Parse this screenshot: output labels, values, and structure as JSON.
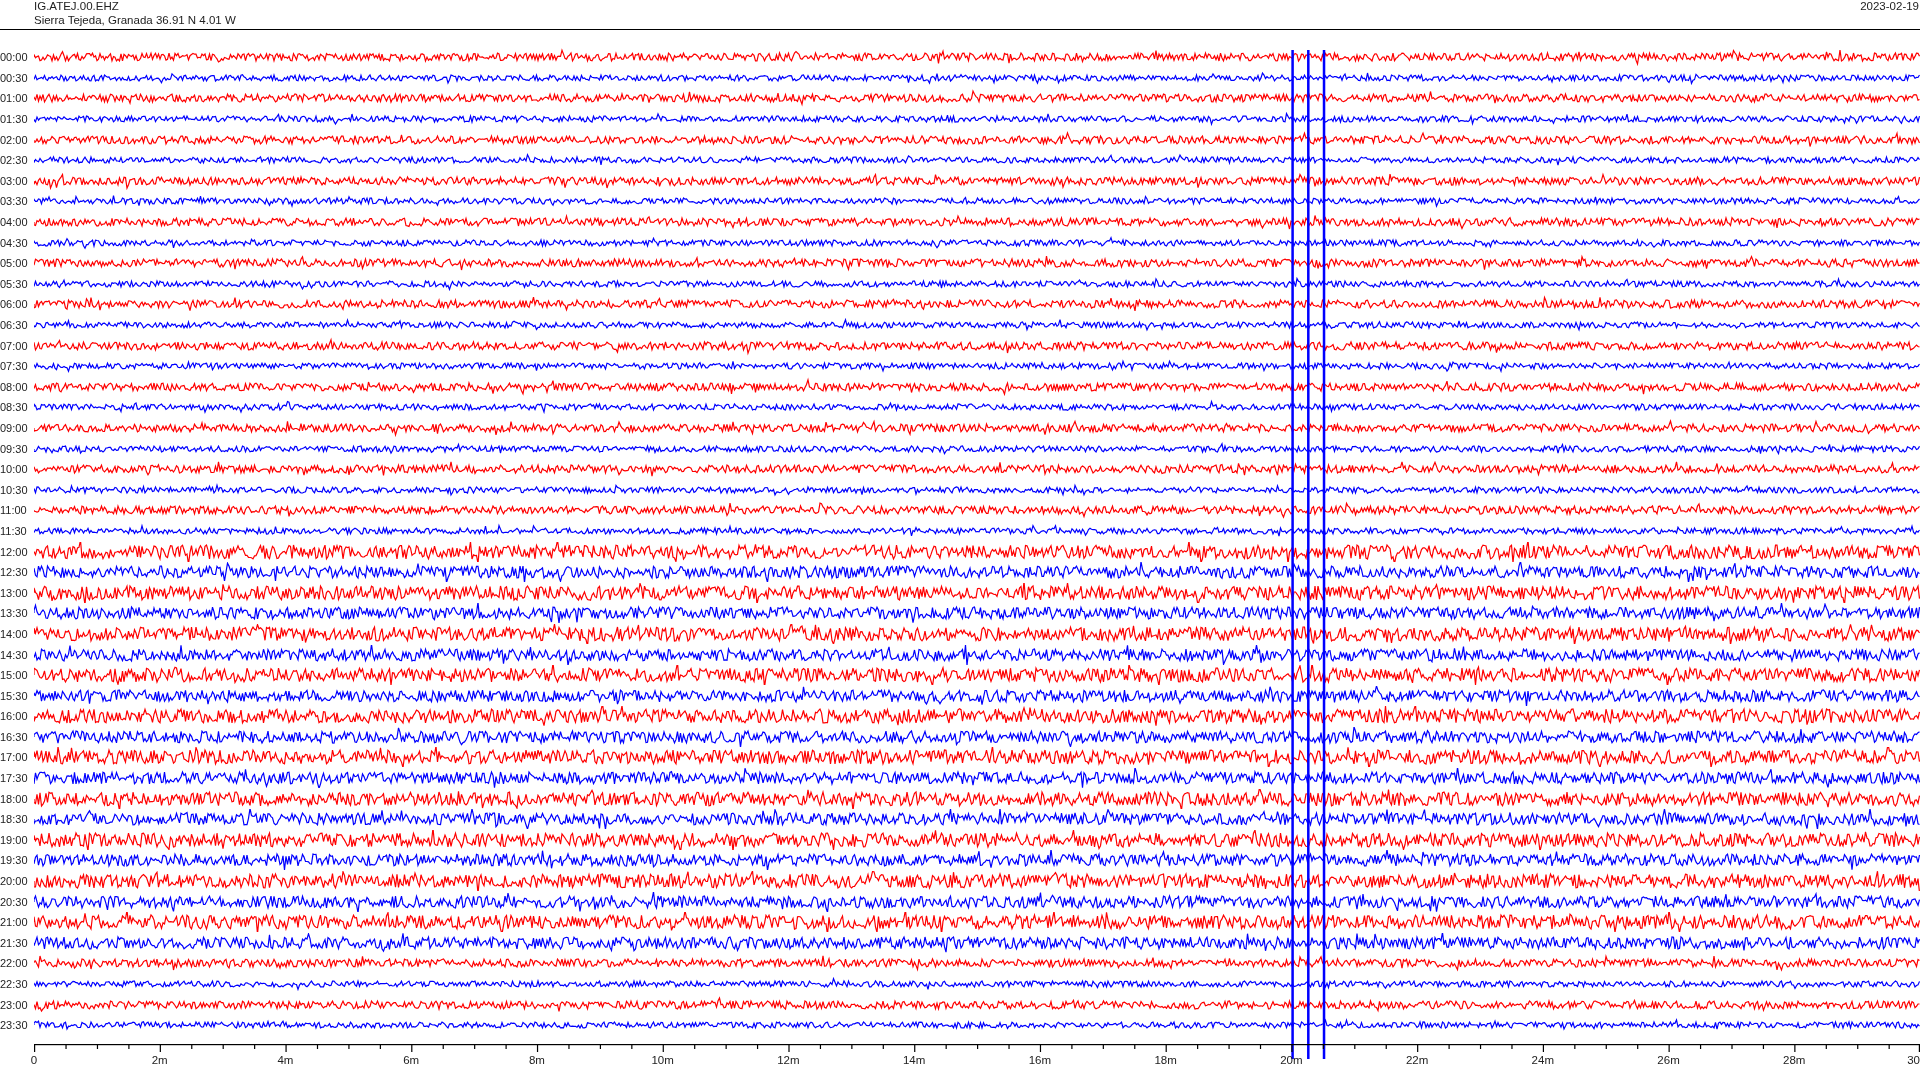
{
  "header": {
    "station": "IG.ATEJ.00.EHZ",
    "location": "Sierra Tejeda, Granada  36.91 N 4.01 W",
    "date": "2023-02-19"
  },
  "traces": [
    {
      "time": "00:00",
      "color": "#ff0000"
    },
    {
      "time": "00:30",
      "color": "#0000ff"
    },
    {
      "time": "01:00",
      "color": "#ff0000"
    },
    {
      "time": "01:30",
      "color": "#0000ff"
    },
    {
      "time": "02:00",
      "color": "#ff0000"
    },
    {
      "time": "02:30",
      "color": "#0000ff"
    },
    {
      "time": "03:00",
      "color": "#ff0000"
    },
    {
      "time": "03:30",
      "color": "#0000ff"
    },
    {
      "time": "04:00",
      "color": "#ff0000"
    },
    {
      "time": "04:30",
      "color": "#0000ff"
    },
    {
      "time": "05:00",
      "color": "#ff0000"
    },
    {
      "time": "05:30",
      "color": "#0000ff"
    },
    {
      "time": "06:00",
      "color": "#ff0000"
    },
    {
      "time": "06:30",
      "color": "#0000ff"
    },
    {
      "time": "07:00",
      "color": "#ff0000"
    },
    {
      "time": "07:30",
      "color": "#0000ff"
    },
    {
      "time": "08:00",
      "color": "#ff0000"
    },
    {
      "time": "08:30",
      "color": "#0000ff"
    },
    {
      "time": "09:00",
      "color": "#ff0000"
    },
    {
      "time": "09:30",
      "color": "#0000ff"
    },
    {
      "time": "10:00",
      "color": "#ff0000"
    },
    {
      "time": "10:30",
      "color": "#0000ff"
    },
    {
      "time": "11:00",
      "color": "#ff0000"
    },
    {
      "time": "11:30",
      "color": "#0000ff"
    },
    {
      "time": "12:00",
      "color": "#ff0000"
    },
    {
      "time": "12:30",
      "color": "#0000ff"
    },
    {
      "time": "13:00",
      "color": "#ff0000"
    },
    {
      "time": "13:30",
      "color": "#0000ff"
    },
    {
      "time": "14:00",
      "color": "#ff0000"
    },
    {
      "time": "14:30",
      "color": "#0000ff"
    },
    {
      "time": "15:00",
      "color": "#ff0000"
    },
    {
      "time": "15:30",
      "color": "#0000ff"
    },
    {
      "time": "16:00",
      "color": "#ff0000"
    },
    {
      "time": "16:30",
      "color": "#0000ff"
    },
    {
      "time": "17:00",
      "color": "#ff0000"
    },
    {
      "time": "17:30",
      "color": "#0000ff"
    },
    {
      "time": "18:00",
      "color": "#ff0000"
    },
    {
      "time": "18:30",
      "color": "#0000ff"
    },
    {
      "time": "19:00",
      "color": "#ff0000"
    },
    {
      "time": "19:30",
      "color": "#0000ff"
    },
    {
      "time": "20:00",
      "color": "#ff0000"
    },
    {
      "time": "20:30",
      "color": "#0000ff"
    },
    {
      "time": "21:00",
      "color": "#ff0000"
    },
    {
      "time": "21:30",
      "color": "#0000ff"
    },
    {
      "time": "22:00",
      "color": "#ff0000"
    },
    {
      "time": "22:30",
      "color": "#0000ff"
    },
    {
      "time": "23:00",
      "color": "#ff0000"
    },
    {
      "time": "23:30",
      "color": "#0000ff"
    }
  ],
  "x_axis": {
    "labels": [
      "0",
      "2m",
      "4m",
      "6m",
      "8m",
      "10m",
      "12m",
      "14m",
      "16m",
      "18m",
      "20m",
      "22m",
      "24m",
      "26m",
      "28m",
      "30"
    ]
  }
}
